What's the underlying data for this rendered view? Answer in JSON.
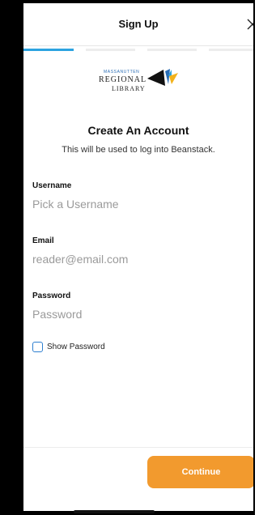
{
  "header": {
    "title": "Sign Up"
  },
  "progress": {
    "total_steps": 4,
    "current_step": 1,
    "active_color": "#2da3e0"
  },
  "logo": {
    "line1": "MASSANUTTEN",
    "line2": "REGIONAL",
    "line3": "LIBRARY"
  },
  "form": {
    "title": "Create An Account",
    "subtitle": "This will be used to log into Beanstack.",
    "username": {
      "label": "Username",
      "placeholder": "Pick a Username"
    },
    "email": {
      "label": "Email",
      "placeholder": "reader@email.com"
    },
    "password": {
      "label": "Password",
      "placeholder": "Password"
    },
    "show_password": {
      "label": "Show Password",
      "checked": false
    }
  },
  "footer": {
    "continue_label": "Continue",
    "button_color": "#f29a2e"
  },
  "icons": {
    "close": "close-icon",
    "checkbox": "checkbox-icon"
  }
}
